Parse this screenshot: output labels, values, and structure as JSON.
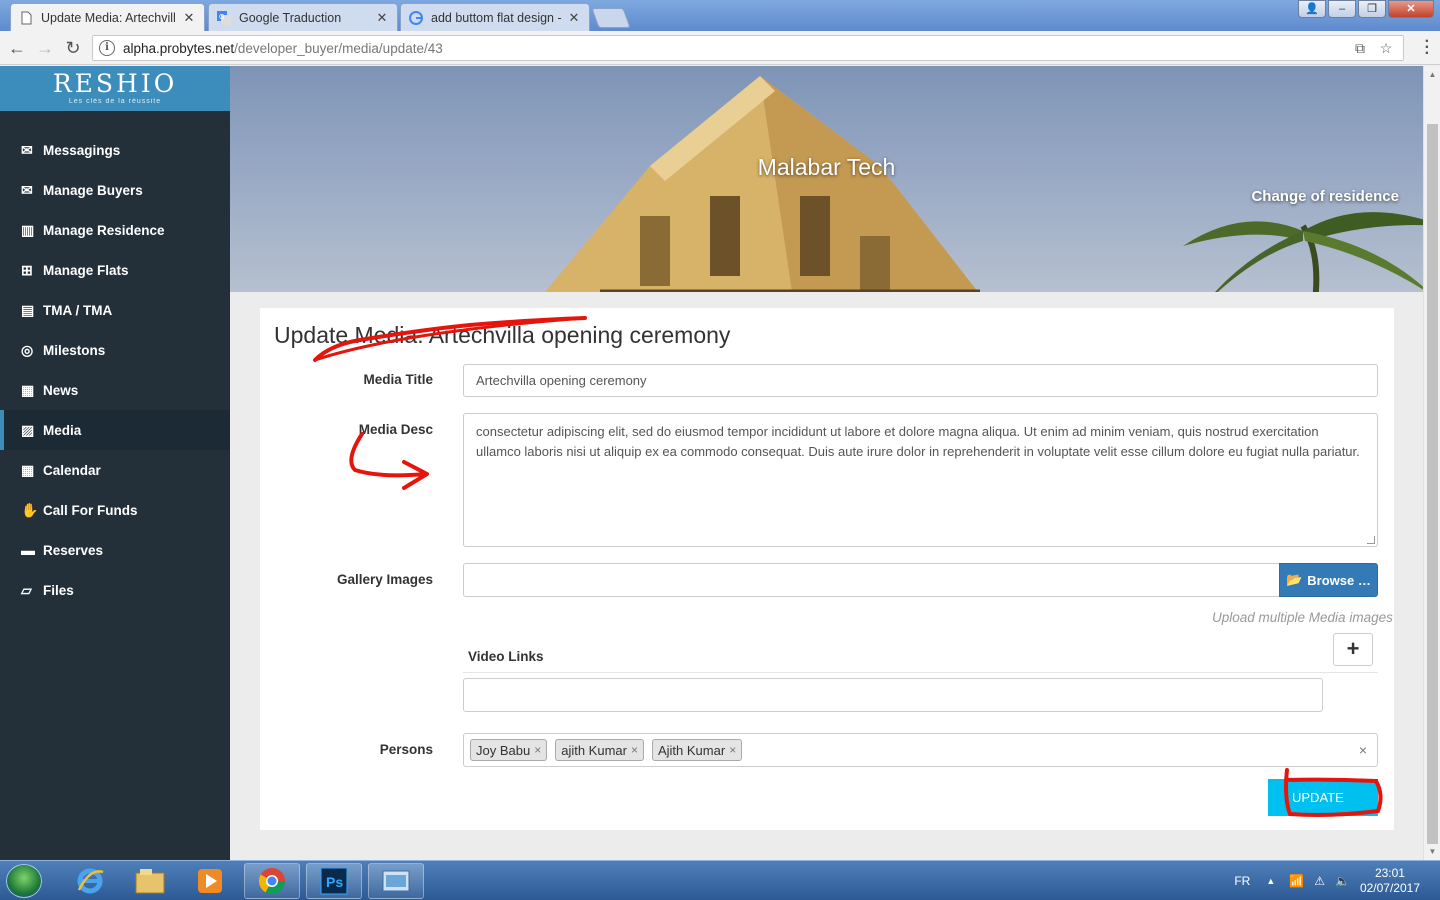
{
  "browser": {
    "tabs": [
      {
        "label": "Update Media: Artechvill",
        "active": true
      },
      {
        "label": "Google Traduction",
        "active": false
      },
      {
        "label": "add buttom flat design -",
        "active": false
      }
    ],
    "url": "alpha.probytes.net/developer_buyer/media/update/43",
    "url_host": "alpha.probytes.net",
    "url_path": "/developer_buyer/media/update/43"
  },
  "sidebar": {
    "logo": "RESHIO",
    "logo_tagline": "Les clés de la réussite",
    "items": [
      {
        "label": "Messagings",
        "icon": "envelope-icon"
      },
      {
        "label": "Manage Buyers",
        "icon": "envelope-icon"
      },
      {
        "label": "Manage Residence",
        "icon": "building-icon"
      },
      {
        "label": "Manage Flats",
        "icon": "grid-icon"
      },
      {
        "label": "TMA / TMA",
        "icon": "building-question-icon"
      },
      {
        "label": "Milestons",
        "icon": "target-icon"
      },
      {
        "label": "News",
        "icon": "newspaper-icon"
      },
      {
        "label": "Media",
        "icon": "image-icon",
        "active": true
      },
      {
        "label": "Calendar",
        "icon": "calendar-icon"
      },
      {
        "label": "Call For Funds",
        "icon": "funds-icon"
      },
      {
        "label": "Reserves",
        "icon": "reserves-icon"
      },
      {
        "label": "Files",
        "icon": "folder-icon"
      }
    ]
  },
  "hero": {
    "title": "Malabar Tech",
    "subtitle": "Change of residence"
  },
  "form": {
    "heading": "Update Media: Artechvilla opening ceremony",
    "media_title_label": "Media Title",
    "media_title_value": "Artechvilla opening ceremony",
    "media_desc_label": "Media Desc",
    "media_desc_value": "consectetur adipiscing elit, sed do eiusmod tempor incididunt ut labore et dolore magna aliqua. Ut enim ad minim veniam, quis nostrud exercitation ullamco laboris nisi ut aliquip ex ea commodo consequat. Duis aute irure dolor in reprehenderit in voluptate velit esse cillum dolore eu fugiat nulla pariatur.",
    "gallery_label": "Gallery Images",
    "browse_label": "Browse …",
    "gallery_hint": "Upload multiple Media images",
    "video_links_label": "Video Links",
    "persons_label": "Persons",
    "persons": [
      "Joy Babu",
      "ajith Kumar",
      "Ajith Kumar"
    ],
    "update_label": "UPDATE"
  },
  "taskbar": {
    "lang": "FR",
    "time": "23:01",
    "date": "02/07/2017"
  },
  "colors": {
    "sidebar_bg": "#233039",
    "logo_bg": "#3c8dbc",
    "update_button": "#00c0ef",
    "browse_button": "#337ab7",
    "annotation": "#e5140c"
  }
}
